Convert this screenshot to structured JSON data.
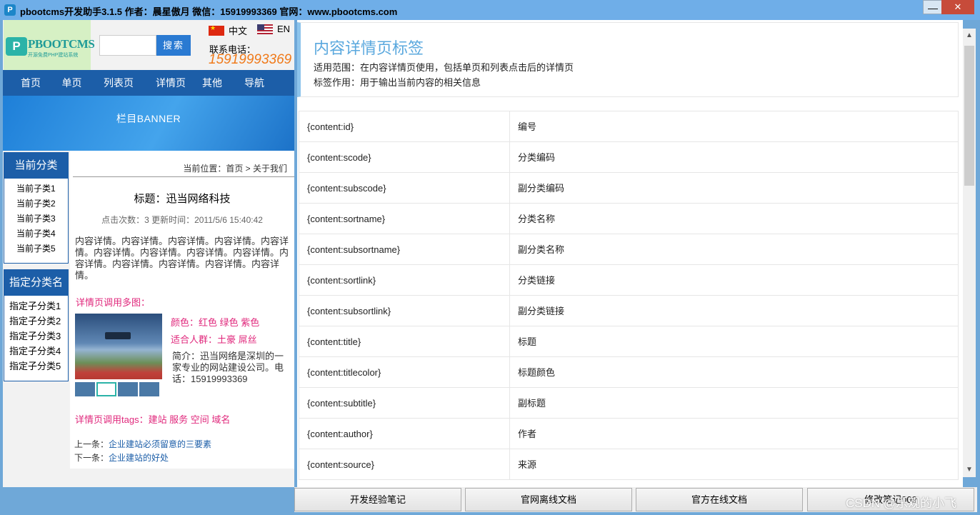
{
  "window": {
    "title": "pbootcms开发助手3.1.5 作者：晨星傲月 微信：15919993369 官网：www.pbootcms.com",
    "minimize": "—",
    "maximize": "▢",
    "close": "✕"
  },
  "preview": {
    "logo": {
      "text": "PBOOTCMS",
      "subtitle": "开源免费PHP建站系统"
    },
    "search": {
      "button": "搜索",
      "value": ""
    },
    "lang": {
      "cn": "中文",
      "en": "EN"
    },
    "phone": {
      "label": "联系电话：",
      "number": "15919993369"
    },
    "nav": [
      "首页",
      "单页",
      "列表页",
      "详情页",
      "其他",
      "导航"
    ],
    "banner": "栏目BANNER",
    "current_category": {
      "title": "当前分类",
      "items": [
        "当前子类1",
        "当前子类2",
        "当前子类3",
        "当前子类4",
        "当前子类5"
      ]
    },
    "specified_category": {
      "title": "指定分类名",
      "items": [
        "指定子分类1",
        "指定子分类2",
        "指定子分类3",
        "指定子分类4",
        "指定子分类5"
      ]
    },
    "breadcrumb": "当前位置：首页 > 关于我们",
    "article": {
      "title": "标题：迅当网络科技",
      "meta": "点击次数：3  更新时间：2011/5/6 15:40:42",
      "body": "内容详情。内容详情。内容详情。内容详情。内容详情。内容详情。内容详情。内容详情。内容详情。内容详情。内容详情。内容详情。内容详情。内容详情。",
      "multi_image_label": "详情页调用多图：",
      "attr_color": "颜色：红色  绿色  紫色",
      "attr_people": "适合人群：土豪  屌丝",
      "intro": "简介：迅当网络是深圳的一家专业的网站建设公司。电话：15919993369",
      "tags": "详情页调用tags：建站  服务  空间  域名",
      "prev_label": "上一条：",
      "prev_link": "企业建站必须留意的三要素",
      "next_label": "下一条：",
      "next_link": "企业建站的好处"
    }
  },
  "docs": {
    "title": "内容详情页标签",
    "scope": "适用范围：在内容详情页使用，包括单页和列表点击后的详情页",
    "purpose": "标签作用：用于输出当前内容的相关信息",
    "rows": [
      {
        "tag": "{content:id}",
        "desc": "编号"
      },
      {
        "tag": "{content:scode}",
        "desc": "分类编码"
      },
      {
        "tag": "{content:subscode}",
        "desc": "副分类编码"
      },
      {
        "tag": "{content:sortname}",
        "desc": "分类名称"
      },
      {
        "tag": "{content:subsortname}",
        "desc": "副分类名称"
      },
      {
        "tag": "{content:sortlink}",
        "desc": "分类链接"
      },
      {
        "tag": "{content:subsortlink}",
        "desc": "副分类链接"
      },
      {
        "tag": "{content:title}",
        "desc": "标题"
      },
      {
        "tag": "{content:titlecolor}",
        "desc": "标题颜色"
      },
      {
        "tag": "{content:subtitle}",
        "desc": "副标题"
      },
      {
        "tag": "{content:author}",
        "desc": "作者"
      },
      {
        "tag": "{content:source}",
        "desc": "来源"
      }
    ]
  },
  "bottom": {
    "buttons": [
      "开发经验笔记",
      "官网离线文档",
      "官方在线文档",
      "修改笔记009"
    ],
    "watermark": "CSDN @乐观的小飞"
  }
}
